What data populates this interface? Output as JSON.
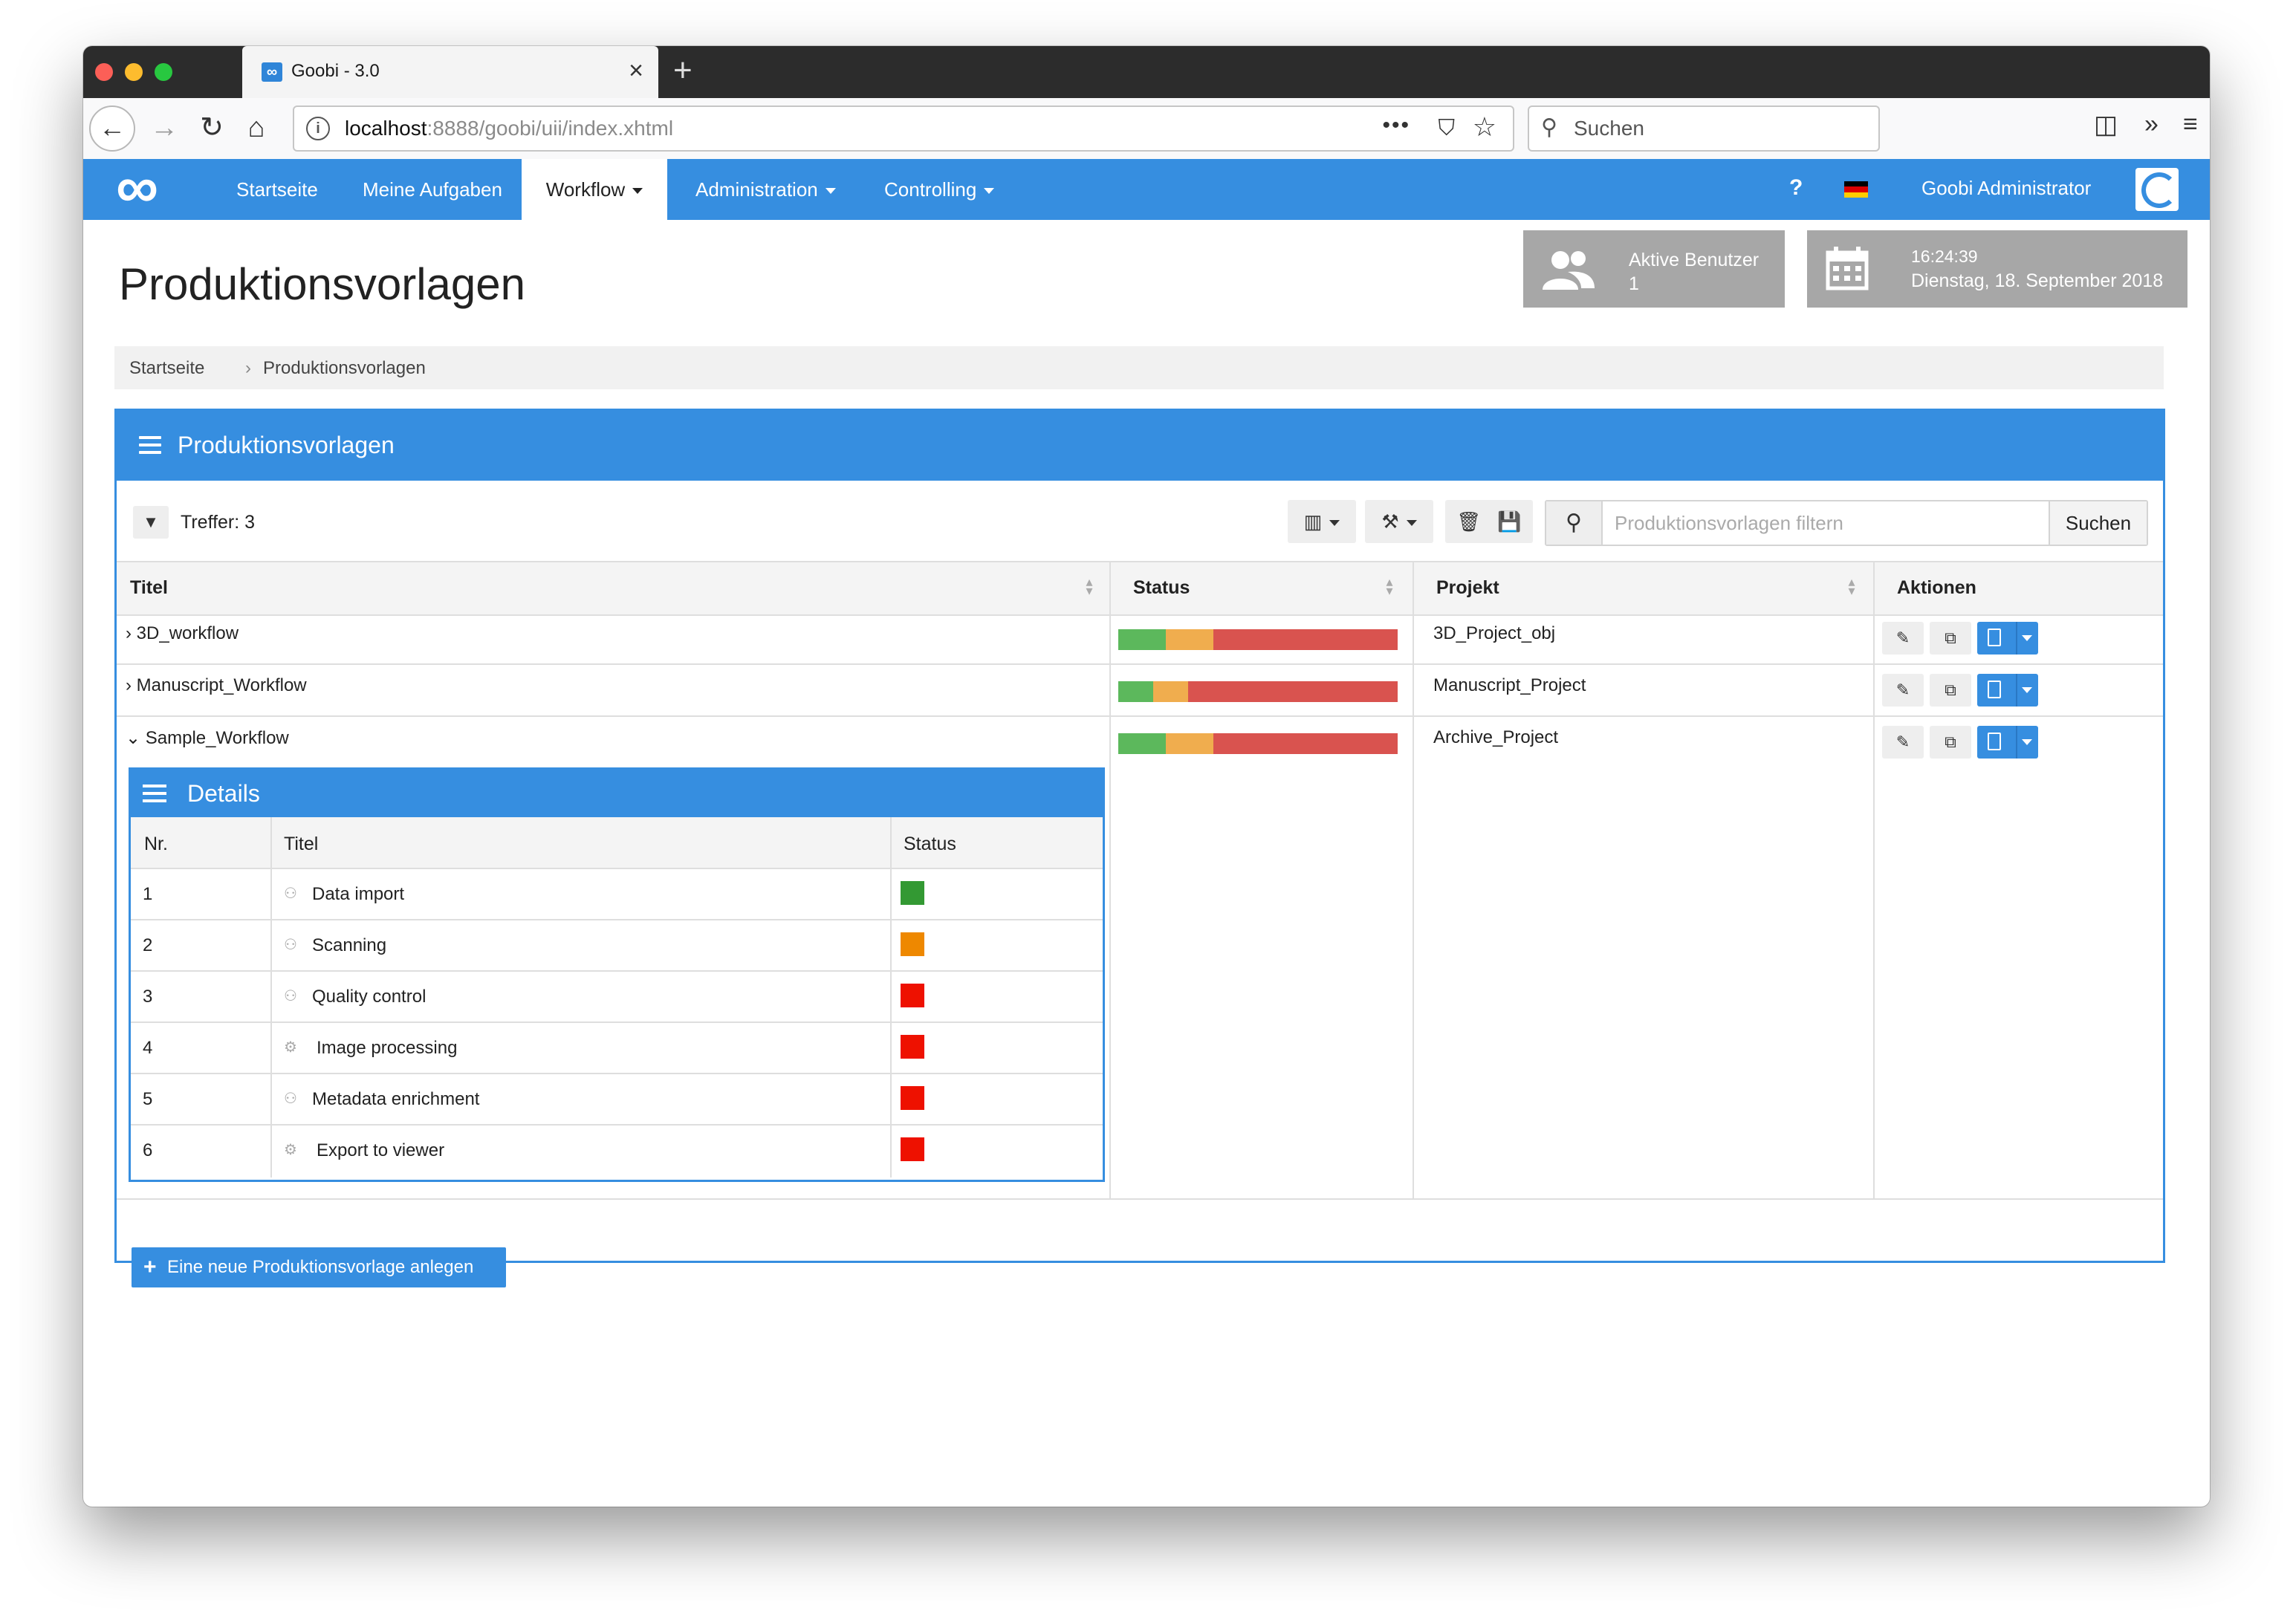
{
  "browser": {
    "tab_title": "Goobi - 3.0",
    "tab_favicon": "infinity-icon",
    "url_host": "localhost",
    "url_rest": ":8888/goobi/uii/index.xhtml",
    "search_placeholder": "Suchen"
  },
  "nav": {
    "items": [
      {
        "label": "Startseite"
      },
      {
        "label": "Meine Aufgaben"
      },
      {
        "label": "Workflow"
      },
      {
        "label": "Administration"
      },
      {
        "label": "Controlling"
      }
    ],
    "help": "?",
    "user": "Goobi Administrator",
    "accent": "#368ee0"
  },
  "header": {
    "title": "Produktionsvorlagen",
    "active_users_label": "Aktive Benutzer",
    "active_users_count": "1",
    "time": "16:24:39",
    "date": "Dienstag, 18. September 2018"
  },
  "breadcrumb": [
    "Startseite",
    "Produktionsvorlagen"
  ],
  "panel": {
    "title": "Produktionsvorlagen",
    "hits": "Treffer: 3",
    "filter_placeholder": "Produktionsvorlagen filtern",
    "search_button": "Suchen",
    "new_button": "Eine neue Produktionsvorlage anlegen"
  },
  "table": {
    "columns": [
      "Titel",
      "Status",
      "Projekt",
      "Aktionen"
    ],
    "rows": [
      {
        "title": "3D_workflow",
        "project": "3D_Project_obj",
        "status": {
          "done": 0.17,
          "open": 0.17,
          "locked": 0.66
        },
        "expanded": false
      },
      {
        "title": "Manuscript_Workflow",
        "project": "Manuscript_Project",
        "status": {
          "done": 0.125,
          "open": 0.125,
          "locked": 0.75
        },
        "expanded": false
      },
      {
        "title": "Sample_Workflow",
        "project": "Archive_Project",
        "status": {
          "done": 0.17,
          "open": 0.17,
          "locked": 0.66
        },
        "expanded": true
      }
    ],
    "status_colors": {
      "done": "#5cb85c",
      "open": "#f0ad4e",
      "locked": "#d9534f"
    }
  },
  "details": {
    "title": "Details",
    "columns": [
      "Nr.",
      "Titel",
      "Status"
    ],
    "steps": [
      {
        "nr": "1",
        "title": "Data import",
        "icon": "user-icon",
        "color": "#339933"
      },
      {
        "nr": "2",
        "title": "Scanning",
        "icon": "user-icon",
        "color": "#ee8800"
      },
      {
        "nr": "3",
        "title": "Quality control",
        "icon": "user-icon",
        "color": "#ee1100"
      },
      {
        "nr": "4",
        "title": "Image processing",
        "icon": "gears-icon",
        "color": "#ee1100"
      },
      {
        "nr": "5",
        "title": "Metadata enrichment",
        "icon": "user-icon",
        "color": "#ee1100"
      },
      {
        "nr": "6",
        "title": "Export to viewer",
        "icon": "gears-icon",
        "color": "#ee1100"
      }
    ]
  }
}
